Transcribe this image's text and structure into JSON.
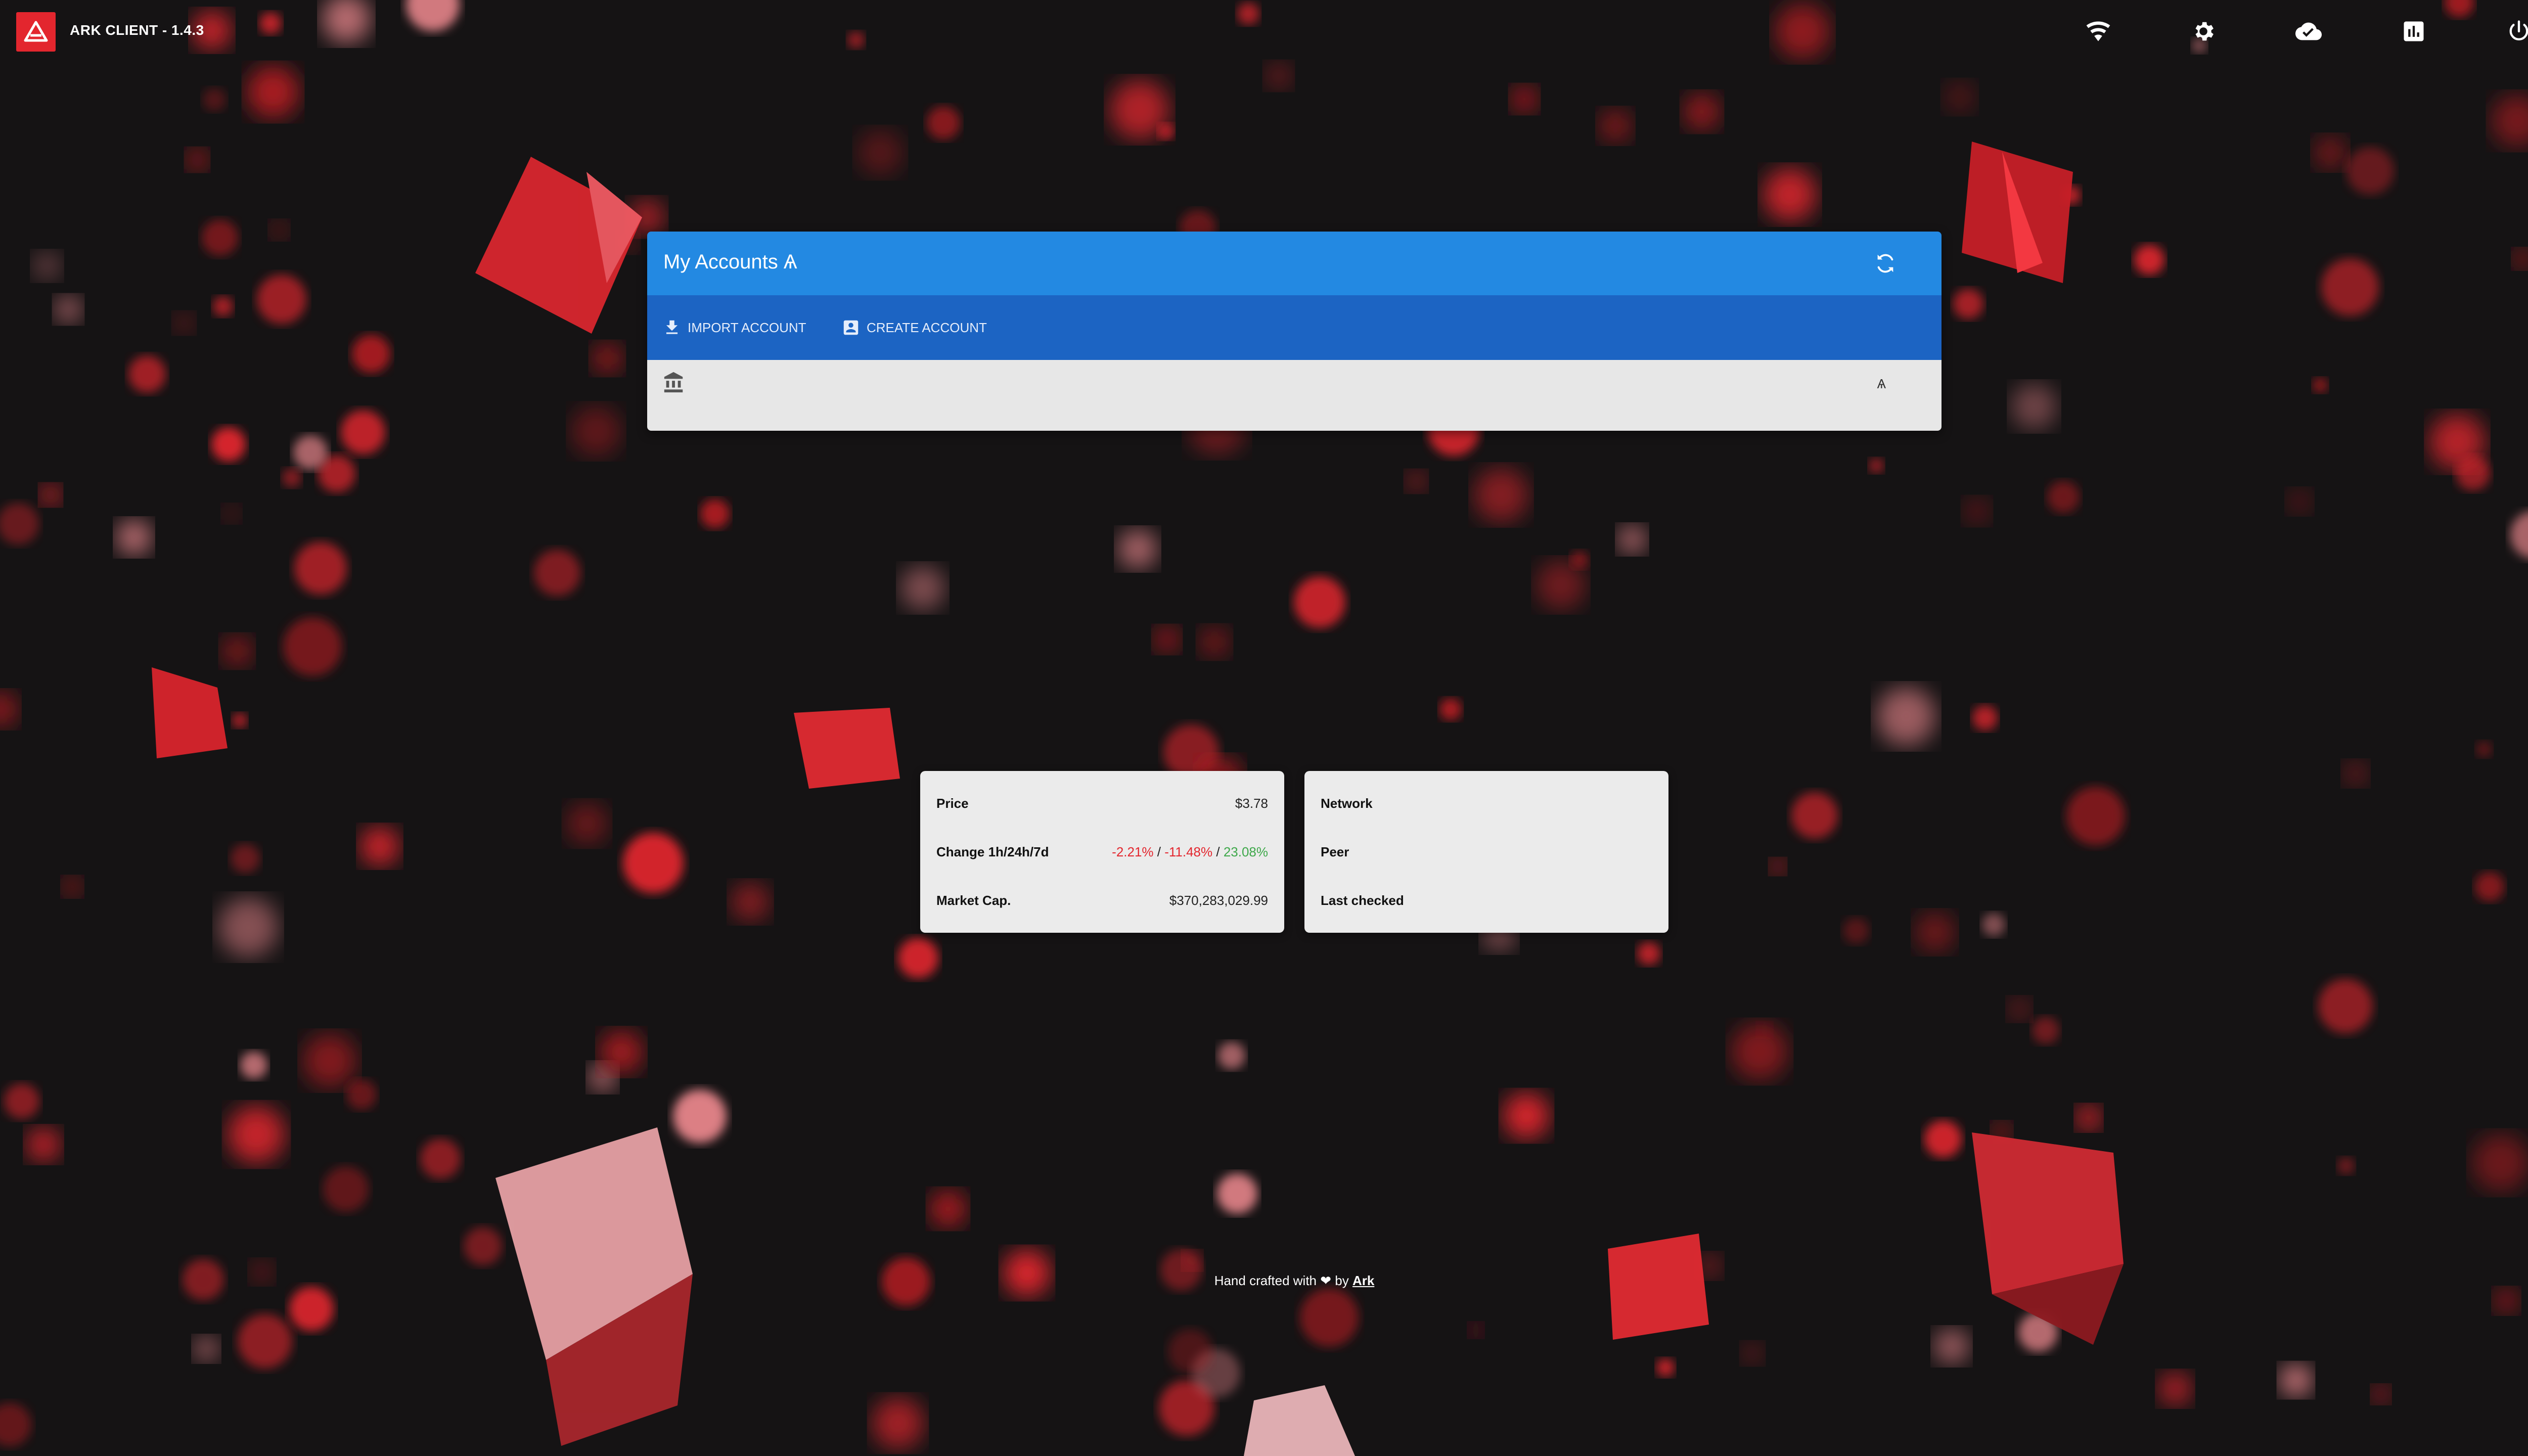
{
  "app": {
    "title": "ARK CLIENT - 1.4.3"
  },
  "topbar": {
    "icons": [
      "wifi-icon",
      "settings-gear-icon",
      "cloud-icon",
      "analytics-chart-icon",
      "power-icon"
    ]
  },
  "accounts": {
    "title": "My Accounts Ѧ",
    "import_label": "IMPORT ACCOUNT",
    "create_label": "CREATE ACCOUNT",
    "row_symbol": "Ѧ"
  },
  "price_card": {
    "price_label": "Price",
    "price_value": "$3.78",
    "change_label": "Change 1h/24h/7d",
    "change_1h": "-2.21%",
    "change_24h": "-11.48%",
    "change_7d": "23.08%",
    "sep": " / ",
    "mcap_label": "Market Cap.",
    "mcap_value": "$370,283,029.99"
  },
  "network_card": {
    "network_label": "Network",
    "peer_label": "Peer",
    "checked_label": "Last checked"
  },
  "footer": {
    "text": "Hand crafted with ❤ by",
    "link": "Ark"
  },
  "colors": {
    "accent_red": "#e3262e",
    "header_blue": "#2389e2",
    "toolbar_blue": "#1c64c3",
    "negative": "#e3262e",
    "positive": "#3ea84a"
  }
}
